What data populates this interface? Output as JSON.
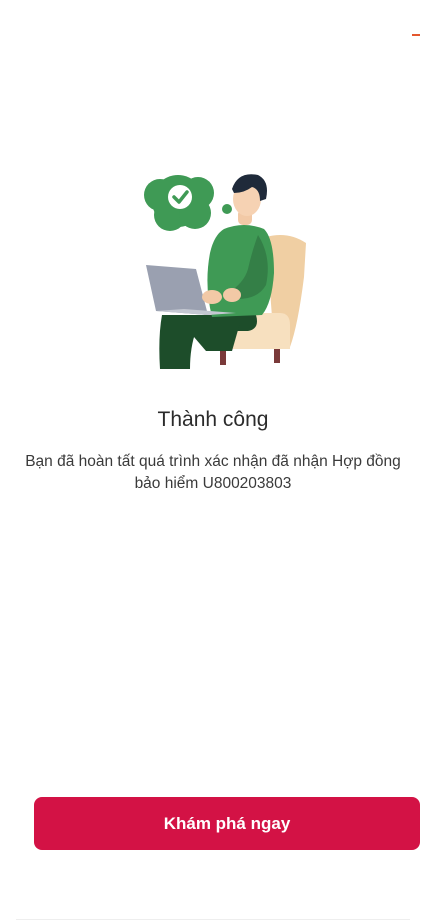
{
  "header": {
    "close_icon": "minus-icon"
  },
  "illustration": {
    "icon": "success-illustration",
    "accent": "#3f9a55"
  },
  "result": {
    "title": "Thành công",
    "message": "Bạn đã hoàn tất quá trình xác nhận đã nhận Hợp đồng bảo hiểm U800203803"
  },
  "actions": {
    "explore_label": "Khám phá ngay",
    "color": "#d31245"
  }
}
